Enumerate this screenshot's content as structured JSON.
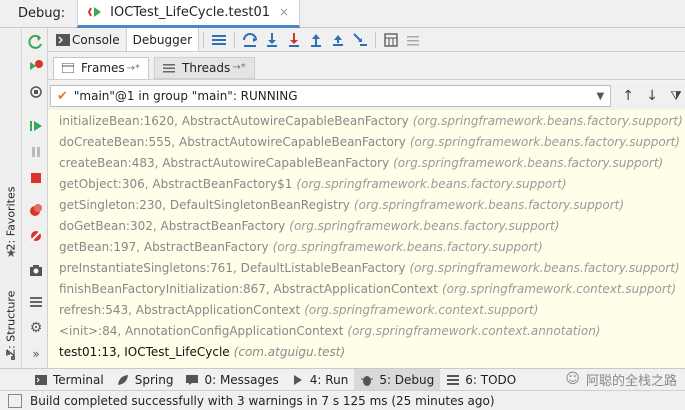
{
  "header": {
    "label": "Debug:",
    "run_tab": "IOCTest_LifeCycle.test01",
    "close": "×"
  },
  "toolbar": {
    "console_label": "Console",
    "debugger_label": "Debugger"
  },
  "subtabs": {
    "frames_label": "Frames",
    "threads_label": "Threads",
    "pin": "→*"
  },
  "thread": {
    "selected": "\"main\"@1 in group \"main\": RUNNING"
  },
  "frames": [
    {
      "fn": "initializeBean:1620, AbstractAutowireCapableBeanFactory",
      "pkg": "(org.springframework.beans.factory.support)"
    },
    {
      "fn": "doCreateBean:555, AbstractAutowireCapableBeanFactory",
      "pkg": "(org.springframework.beans.factory.support)"
    },
    {
      "fn": "createBean:483, AbstractAutowireCapableBeanFactory",
      "pkg": "(org.springframework.beans.factory.support)"
    },
    {
      "fn": "getObject:306, AbstractBeanFactory$1",
      "pkg": "(org.springframework.beans.factory.support)"
    },
    {
      "fn": "getSingleton:230, DefaultSingletonBeanRegistry",
      "pkg": "(org.springframework.beans.factory.support)"
    },
    {
      "fn": "doGetBean:302, AbstractBeanFactory",
      "pkg": "(org.springframework.beans.factory.support)"
    },
    {
      "fn": "getBean:197, AbstractBeanFactory",
      "pkg": "(org.springframework.beans.factory.support)"
    },
    {
      "fn": "preInstantiateSingletons:761, DefaultListableBeanFactory",
      "pkg": "(org.springframework.beans.factory.support)"
    },
    {
      "fn": "finishBeanFactoryInitialization:867, AbstractApplicationContext",
      "pkg": "(org.springframework.context.support)"
    },
    {
      "fn": "refresh:543, AbstractApplicationContext",
      "pkg": "(org.springframework.context.support)"
    },
    {
      "fn": "<init>:84, AnnotationConfigApplicationContext",
      "pkg": "(org.springframework.context.annotation)"
    },
    {
      "fn": "test01:13, IOCTest_LifeCycle",
      "pkg": "(com.atguigu.test)"
    }
  ],
  "side": {
    "favorites": "2: Favorites",
    "structure": "Z: Structure",
    "more": "»"
  },
  "bottom_tabs": [
    {
      "label": "Terminal"
    },
    {
      "label": "Spring"
    },
    {
      "label": "0: Messages"
    },
    {
      "label": "4: Run"
    },
    {
      "label": "5: Debug"
    },
    {
      "label": "6: TODO"
    }
  ],
  "watermark": "阿聪的全栈之路",
  "status": "Build completed successfully with 3 warnings in 7 s 125 ms (25 minutes ago)",
  "colors": {
    "frame_bg": "#fefee9",
    "accent": "#4a87c7",
    "resume_green": "#3aa657",
    "stop_red": "#d9342b"
  }
}
